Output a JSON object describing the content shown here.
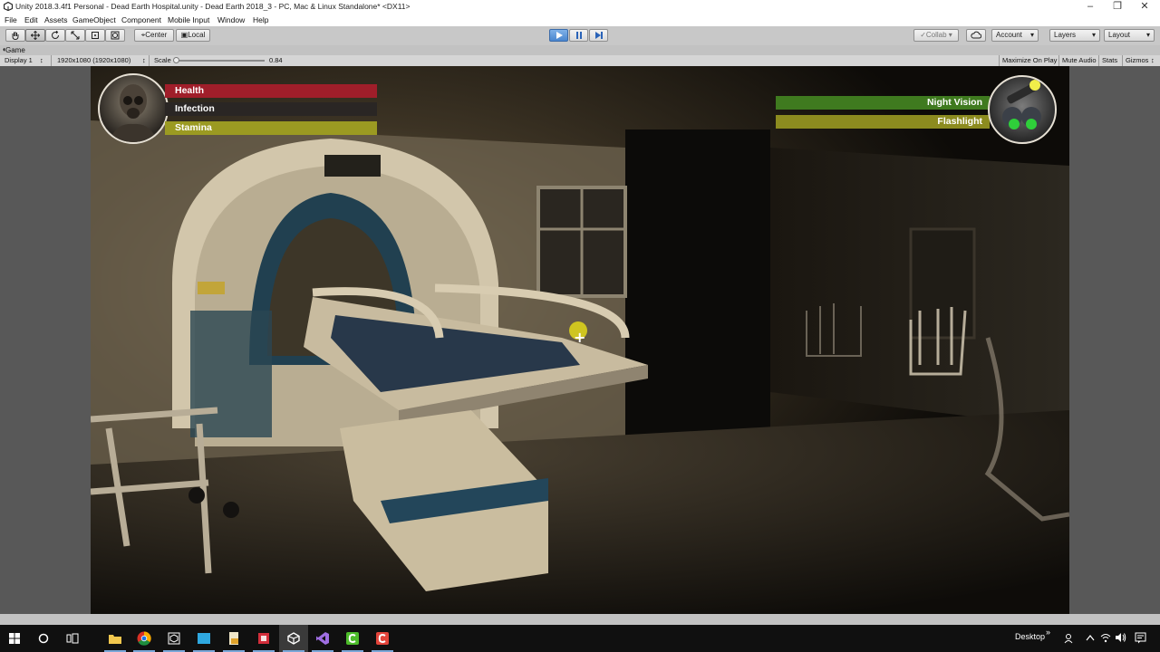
{
  "window": {
    "title": "Unity 2018.3.4f1 Personal - Dead Earth Hospital.unity - Dead Earth 2018_3 - PC, Mac & Linux Standalone* <DX11>",
    "controls": [
      "–",
      "❐",
      "✕"
    ]
  },
  "menu": [
    "File",
    "Edit",
    "Assets",
    "GameObject",
    "Component",
    "Mobile Input",
    "Window",
    "Help"
  ],
  "toolbar": {
    "pivot_mode": "Center",
    "pivot_rotation": "Local",
    "collab": "Collab ▾",
    "account": "Account",
    "layers": "Layers",
    "layout": "Layout",
    "dropdown_arrow": "▾"
  },
  "game_tab": {
    "label": "Game",
    "display": "Display 1",
    "resolution": "1920x1080 (1920x1080)",
    "scale_label": "Scale",
    "scale_value": "0.84",
    "maximize_on_play": "Maximize On Play",
    "mute_audio": "Mute Audio",
    "stats": "Stats",
    "gizmos": "Gizmos"
  },
  "hud": {
    "left_bars": [
      {
        "label": "Health",
        "color": "#a01e2a"
      },
      {
        "label": "Infection",
        "color": "#2a2624"
      },
      {
        "label": "Stamina",
        "color": "#9b9a22"
      }
    ],
    "right_bars": [
      {
        "label": "Night Vision",
        "color": "#3f7a1f"
      },
      {
        "label": "Flashlight",
        "color": "#8c8b1f"
      }
    ],
    "crosshair": "+"
  },
  "taskbar": {
    "desktop_label": "Desktop",
    "chevron": "»"
  },
  "colors": {
    "accent_play": "#4a86cf",
    "hud_health": "#a01e2a",
    "hud_stamina": "#9b9a22",
    "hud_nightvision": "#3f7a1f"
  }
}
